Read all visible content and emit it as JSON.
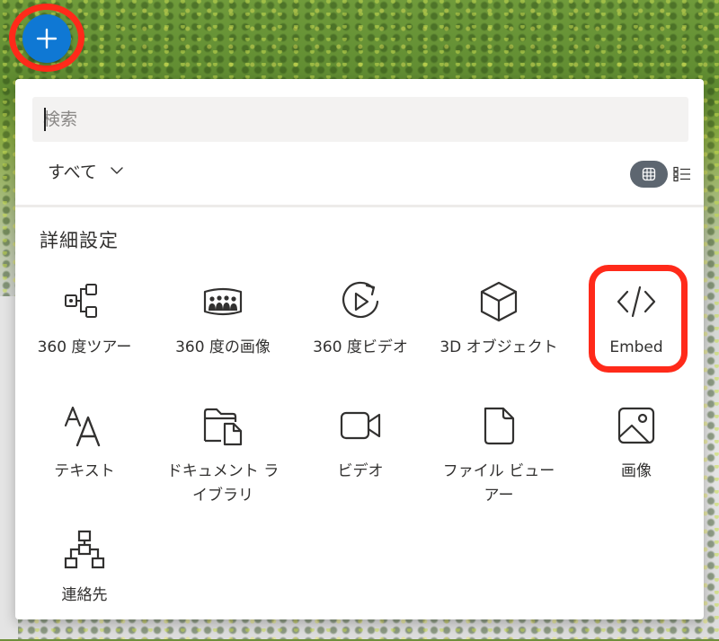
{
  "search": {
    "placeholder": "検索"
  },
  "filter": {
    "label": "すべて",
    "icon": "chevron-down-icon"
  },
  "view_toggle": {
    "grid_icon": "grid-view-icon",
    "list_icon": "list-view-icon",
    "selected": "grid"
  },
  "section": {
    "title": "詳細設定"
  },
  "items": [
    {
      "label": "360 度ツアー",
      "icon": "tour-360-icon"
    },
    {
      "label": "360 度の画像",
      "icon": "image-360-icon"
    },
    {
      "label": "360 度ビデオ",
      "icon": "video-360-icon"
    },
    {
      "label": "3D オブジェクト",
      "icon": "cube-3d-icon"
    },
    {
      "label": "Embed",
      "icon": "code-icon"
    },
    {
      "label": "テキスト",
      "icon": "text-icon"
    },
    {
      "label": "ドキュメント ライブラリ",
      "icon": "document-library-icon"
    },
    {
      "label": "ビデオ",
      "icon": "video-camera-icon"
    },
    {
      "label": "ファイル ビューアー",
      "icon": "file-icon"
    },
    {
      "label": "画像",
      "icon": "image-icon"
    },
    {
      "label": "連絡先",
      "icon": "org-chart-icon"
    }
  ],
  "colors": {
    "fab": "#0f78d4",
    "highlight": "#ff2a1a",
    "toggle_active": "#5d6670",
    "text": "#323130"
  }
}
